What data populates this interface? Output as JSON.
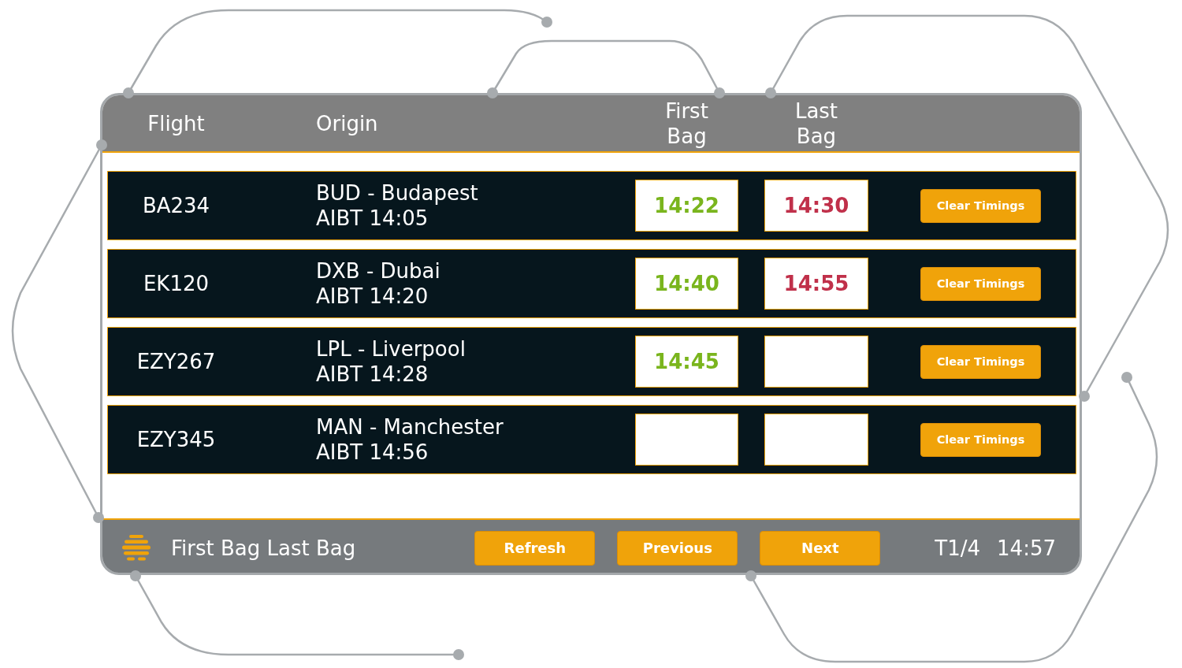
{
  "table": {
    "columns": [
      "Flight",
      "Origin",
      "First Bag",
      "Last Bag"
    ],
    "rows": [
      {
        "flight": "BA234",
        "origin": "BUD - Budapest",
        "aibt": "AIBT 14:05",
        "first_bag": "14:22",
        "last_bag": "14:30",
        "action": "Clear Timings"
      },
      {
        "flight": "EK120",
        "origin": "DXB - Dubai",
        "aibt": "AIBT 14:20",
        "first_bag": "14:40",
        "last_bag": "14:55",
        "action": "Clear Timings"
      },
      {
        "flight": "EZY267",
        "origin": "LPL - Liverpool",
        "aibt": "AIBT 14:28",
        "first_bag": "14:45",
        "action": "Clear Timings"
      },
      {
        "flight": "EZY345",
        "origin": "MAN - Manchester",
        "aibt": "AIBT 14:56",
        "action": "Clear Timings"
      }
    ]
  },
  "footer": {
    "title": "First Bag Last Bag",
    "buttons": [
      "Refresh",
      "Previous",
      "Next"
    ],
    "terminal": "T1/4",
    "clock": "14:57"
  }
}
